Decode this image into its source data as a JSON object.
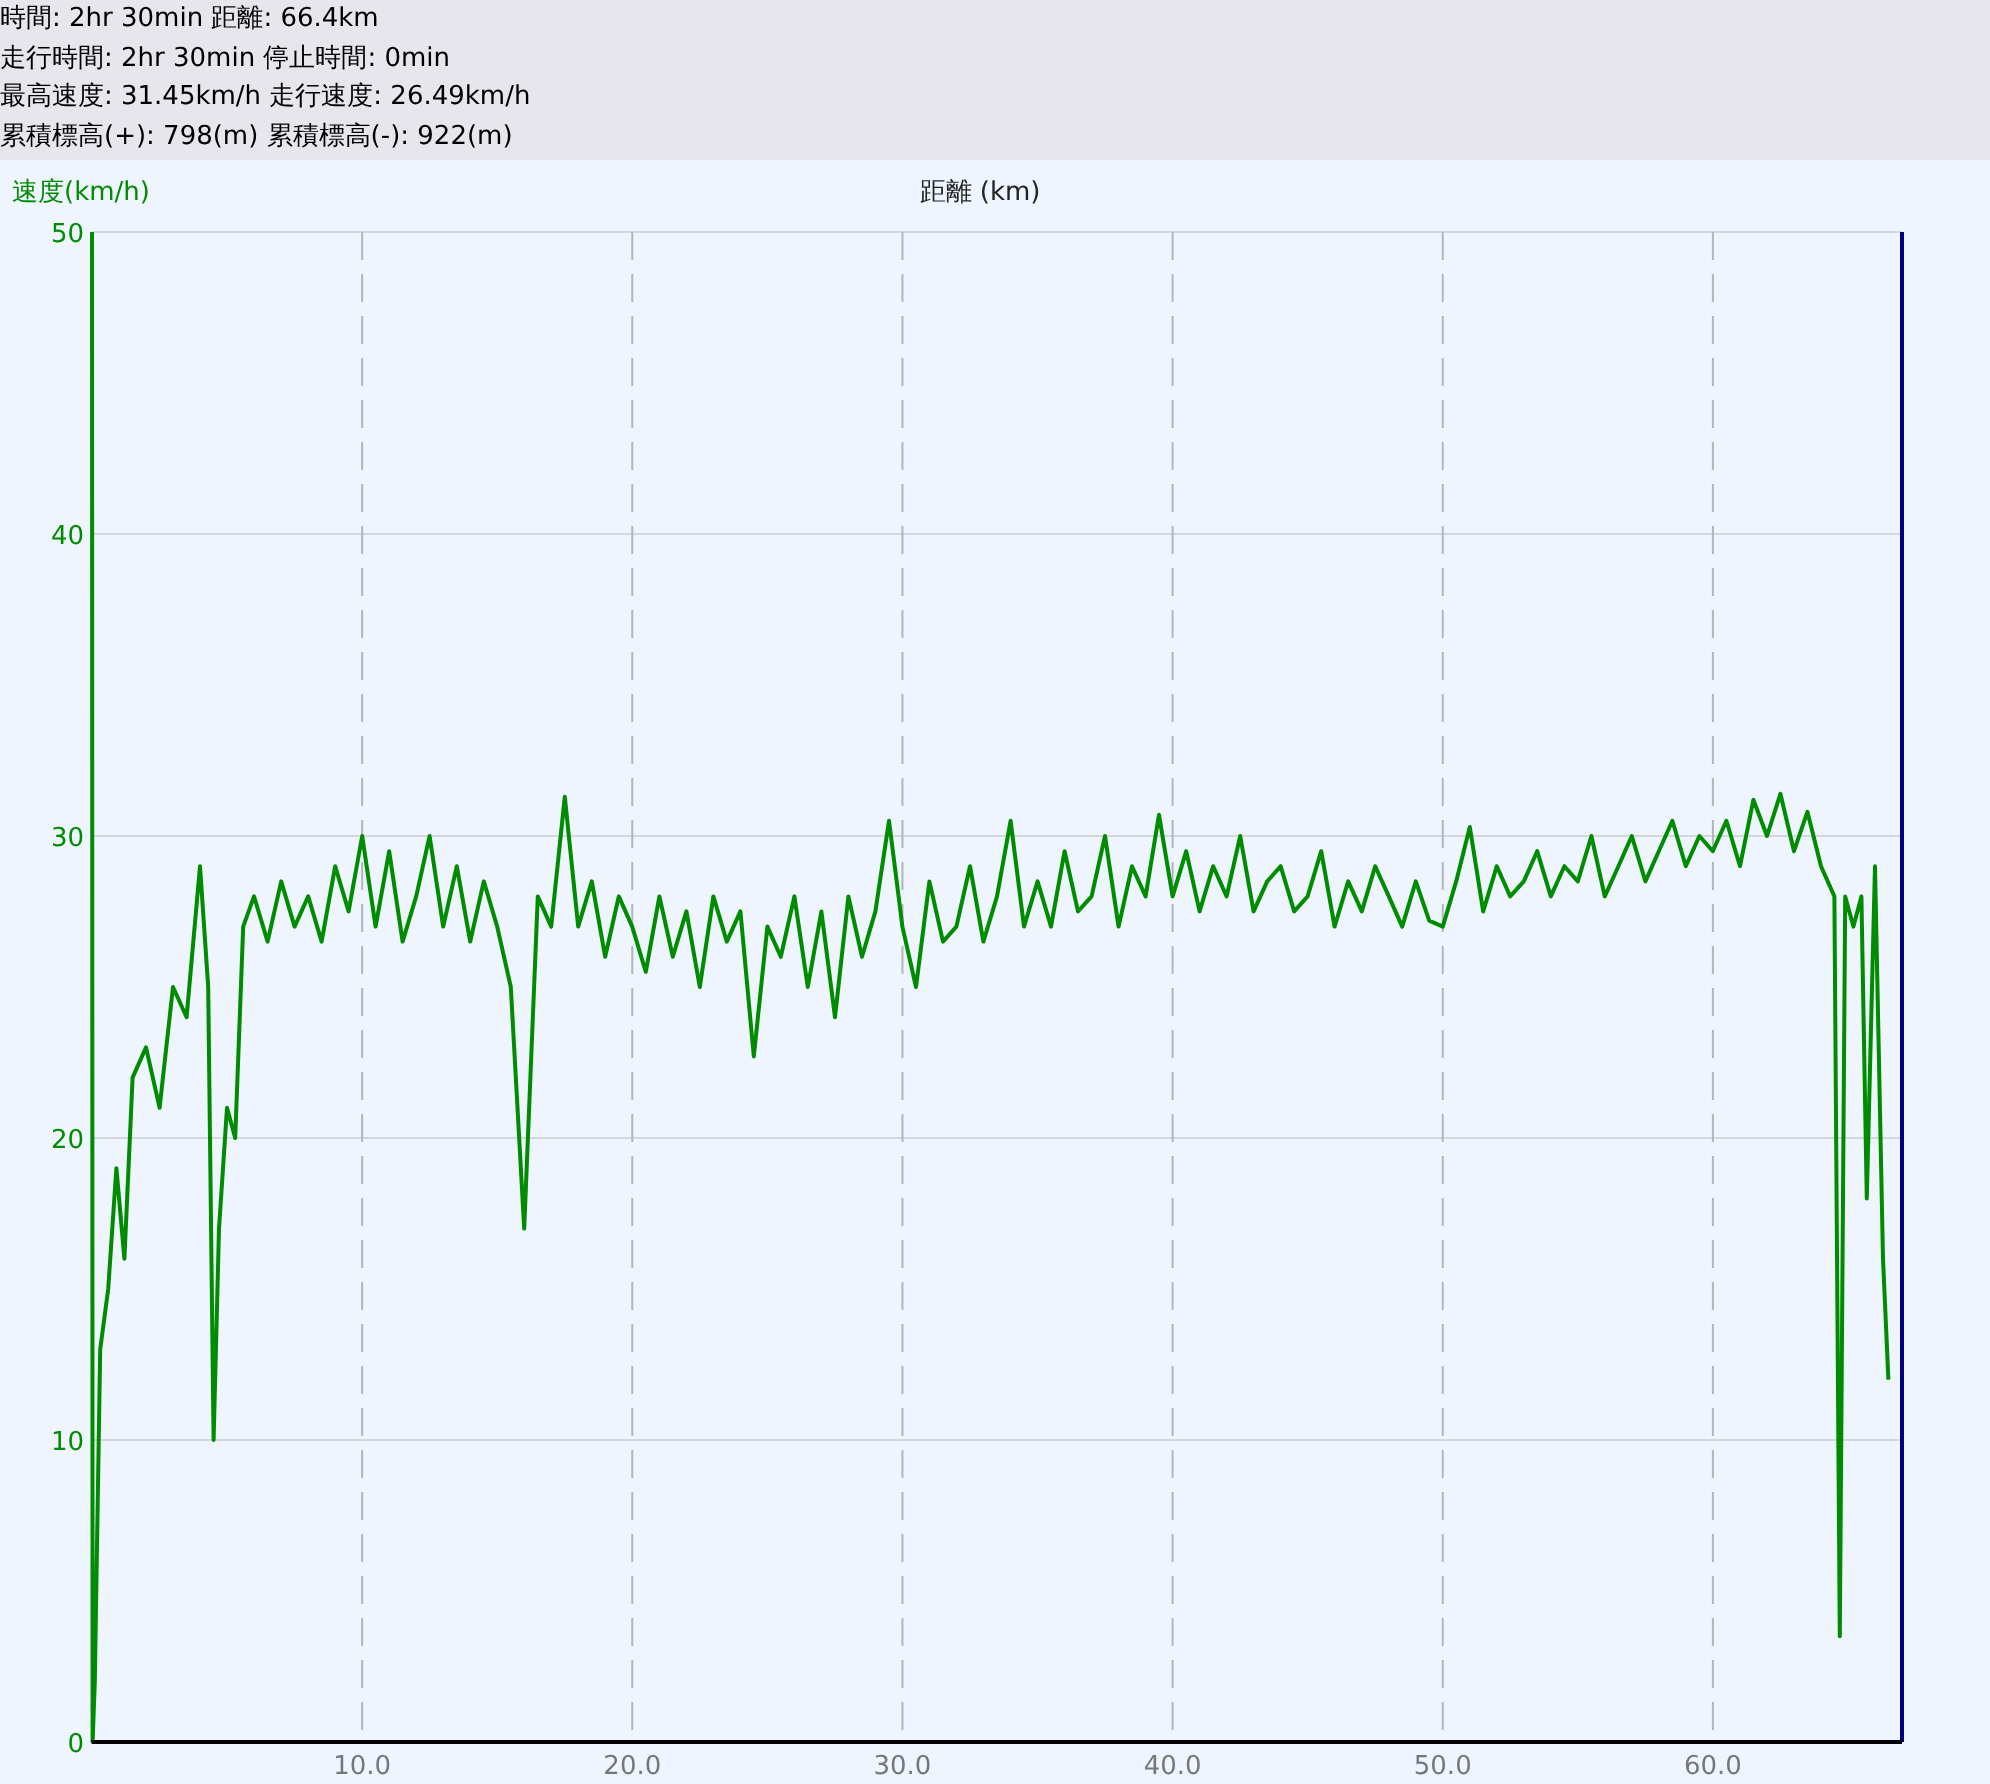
{
  "summary": [
    "時間: 2hr 30min  距離: 66.4km",
    "走行時間: 2hr 30min  停止時間: 0min",
    "最高速度: 31.45km/h  走行速度: 26.49km/h",
    "累積標高(+): 798(m)  累積標高(-): 922(m)"
  ],
  "chart": {
    "chart_data": {
      "type": "line",
      "xlabel": "距離 (km)",
      "ylabel": "速度(km/h)",
      "xlim": [
        0,
        67
      ],
      "ylim": [
        0,
        50
      ],
      "xticks": [
        {
          "value": 10,
          "label": "10.0"
        },
        {
          "value": 20,
          "label": "20.0"
        },
        {
          "value": 30,
          "label": "30.0"
        },
        {
          "value": 40,
          "label": "40.0"
        },
        {
          "value": 50,
          "label": "50.0"
        },
        {
          "value": 60,
          "label": "60.0"
        }
      ],
      "yticks": [
        0,
        10,
        20,
        30,
        40,
        50
      ],
      "grid": true,
      "x": [
        0,
        0.02,
        0.1,
        0.3,
        0.6,
        0.9,
        1.2,
        1.5,
        2,
        2.5,
        3,
        3.5,
        4,
        4.3,
        4.5,
        4.7,
        5,
        5.3,
        5.6,
        6,
        6.5,
        7,
        7.5,
        8,
        8.5,
        9,
        9.5,
        10,
        10.5,
        11,
        11.5,
        12,
        12.5,
        13,
        13.5,
        14,
        14.5,
        15,
        15.5,
        16,
        16.5,
        17,
        17.5,
        18,
        18.5,
        19,
        19.5,
        20,
        20.5,
        21,
        21.5,
        22,
        22.5,
        23,
        23.5,
        24,
        24.5,
        25,
        25.5,
        26,
        26.5,
        27,
        27.5,
        28,
        28.5,
        29,
        29.5,
        30,
        30.5,
        31,
        31.5,
        32,
        32.5,
        33,
        33.5,
        34,
        34.5,
        35,
        35.5,
        36,
        36.5,
        37,
        37.5,
        38,
        38.5,
        39,
        39.5,
        40,
        40.5,
        41,
        41.5,
        42,
        42.5,
        43,
        43.5,
        44,
        44.5,
        45,
        45.5,
        46,
        46.5,
        47,
        47.5,
        48,
        48.5,
        49,
        49.5,
        50,
        50.5,
        51,
        51.5,
        52,
        52.5,
        53,
        53.5,
        54,
        54.5,
        55,
        55.5,
        56,
        56.5,
        57,
        57.5,
        58,
        58.5,
        59,
        59.5,
        60,
        60.5,
        61,
        61.5,
        62,
        62.5,
        63,
        63.5,
        64,
        64.5,
        64.7,
        64.9,
        65.2,
        65.5,
        65.7,
        66,
        66.3,
        66.5
      ],
      "series": [
        {
          "color": "#008c00",
          "values": [
            50,
            0,
            2,
            13,
            15,
            19,
            16,
            22,
            23,
            21,
            25,
            24,
            29,
            25,
            10,
            17,
            21,
            20,
            27,
            28,
            26.5,
            28.5,
            27,
            28,
            26.5,
            29,
            27.5,
            30,
            27,
            29.5,
            26.5,
            28,
            30,
            27,
            29,
            26.5,
            28.5,
            27,
            25,
            17,
            28,
            27,
            31.3,
            27,
            28.5,
            26,
            28,
            27,
            25.5,
            28,
            26,
            27.5,
            25,
            28,
            26.5,
            27.5,
            22.7,
            27,
            26,
            28,
            25,
            27.5,
            24,
            28,
            26,
            27.5,
            30.5,
            27,
            25,
            28.5,
            26.5,
            27,
            29,
            26.5,
            28,
            30.5,
            27,
            28.5,
            27,
            29.5,
            27.5,
            28,
            30,
            27,
            29,
            28,
            30.7,
            28,
            29.5,
            27.5,
            29,
            28,
            30,
            27.5,
            28.5,
            29,
            27.5,
            28,
            29.5,
            27,
            28.5,
            27.5,
            29,
            28,
            27,
            28.5,
            27.2,
            27,
            28.5,
            30.3,
            27.5,
            29,
            28,
            28.5,
            29.5,
            28,
            29,
            28.5,
            30,
            28,
            29,
            30,
            28.5,
            29.5,
            30.5,
            29,
            30,
            29.5,
            30.5,
            29,
            31.2,
            30,
            31.4,
            29.5,
            30.8,
            29,
            28,
            3.5,
            28,
            27,
            28,
            18,
            29,
            16,
            12
          ]
        }
      ]
    }
  }
}
